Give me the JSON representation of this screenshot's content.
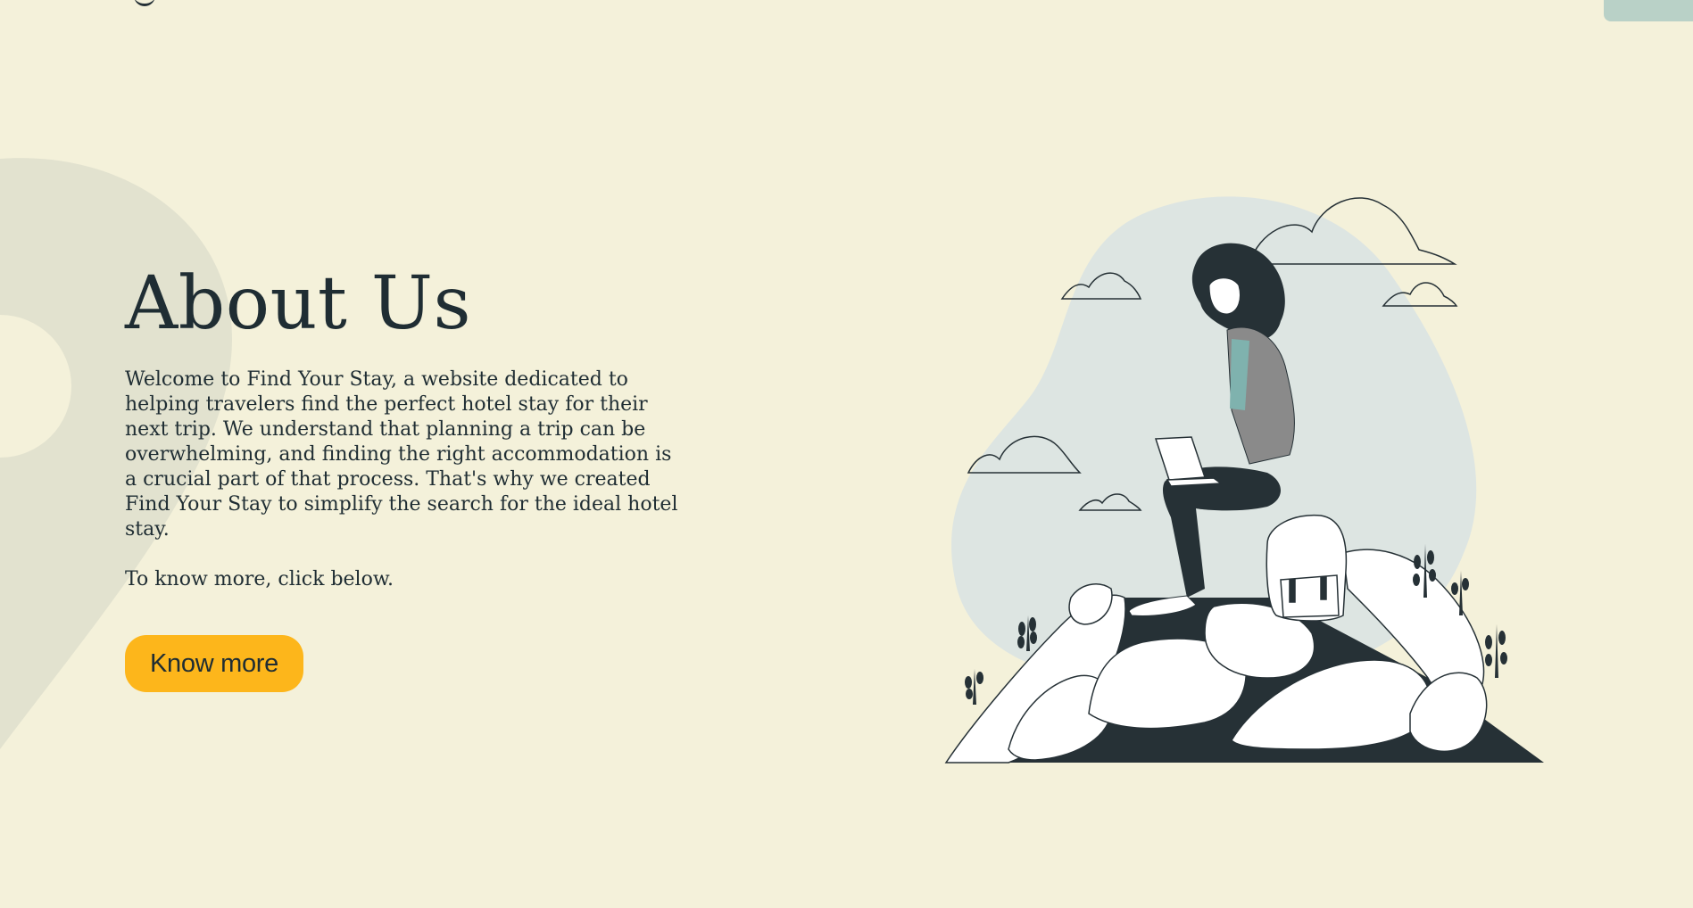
{
  "about": {
    "title": "About Us",
    "paragraph": "Welcome to Find Your Stay, a website dedicated to helping travelers find the perfect hotel stay for their next trip. We understand that planning a trip can be overwhelming, and finding the right accommodation is a crucial part of that process. That's why we created Find Your Stay to simplify the search for the ideal hotel stay.",
    "cta_text": "To know more, click below.",
    "button_label": "Know more"
  },
  "icons": {
    "background": "map-pin-shape",
    "illustration": "woman-on-rocks-with-laptop"
  },
  "colors": {
    "background": "#f4f1da",
    "text": "#1f2d33",
    "button": "#fdb61b",
    "accent": "#b9d1c7",
    "blob": "#dde5e2",
    "dark": "#263136"
  }
}
